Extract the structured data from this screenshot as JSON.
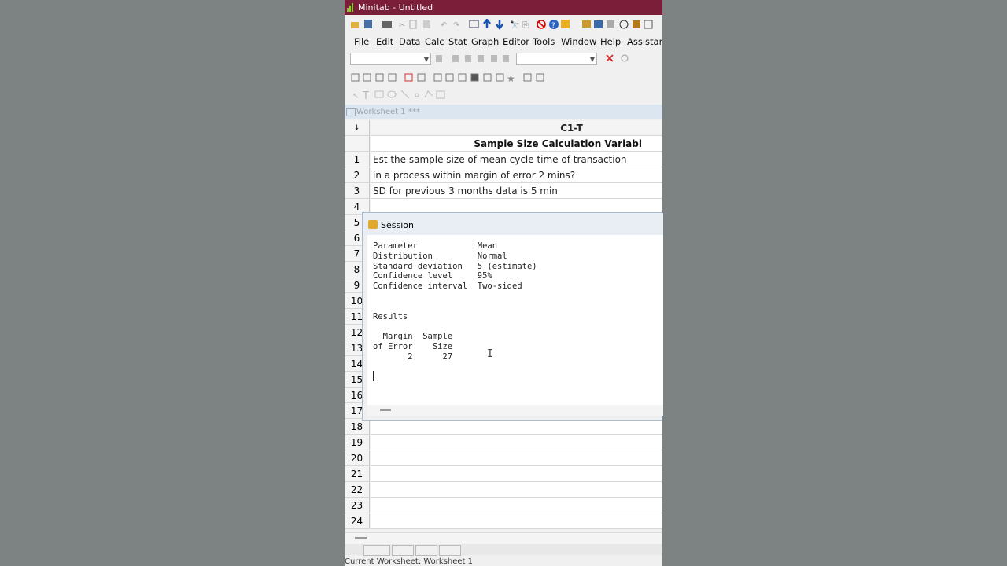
{
  "app": {
    "title": "Minitab - Untitled"
  },
  "menu": [
    "File",
    "Edit",
    "Data",
    "Calc",
    "Stat",
    "Graph",
    "Editor",
    "Tools",
    "Window",
    "Help",
    "Assistant"
  ],
  "worksheet": {
    "title": "Worksheet 1 ***",
    "column_id": "C1-T",
    "column_name": "Sample Size Calculation Variabl",
    "rows": [
      {
        "n": "1",
        "text": "Est the sample size of mean cycle time of transaction"
      },
      {
        "n": "2",
        "text": "in a process within margin of error 2 mins?"
      },
      {
        "n": "3",
        "text": "SD for previous 3 months data is 5 min"
      },
      {
        "n": "4",
        "text": ""
      },
      {
        "n": "5",
        "text": ""
      },
      {
        "n": "6",
        "text": ""
      },
      {
        "n": "7",
        "text": ""
      },
      {
        "n": "8",
        "text": ""
      },
      {
        "n": "9",
        "text": ""
      },
      {
        "n": "10",
        "text": ""
      },
      {
        "n": "11",
        "text": ""
      },
      {
        "n": "12",
        "text": ""
      },
      {
        "n": "13",
        "text": ""
      },
      {
        "n": "14",
        "text": ""
      },
      {
        "n": "15",
        "text": ""
      },
      {
        "n": "16",
        "text": ""
      },
      {
        "n": "17",
        "text": ""
      },
      {
        "n": "18",
        "text": ""
      },
      {
        "n": "19",
        "text": ""
      },
      {
        "n": "20",
        "text": ""
      },
      {
        "n": "21",
        "text": ""
      },
      {
        "n": "22",
        "text": ""
      },
      {
        "n": "23",
        "text": ""
      },
      {
        "n": "24",
        "text": ""
      }
    ]
  },
  "session": {
    "title": "Session",
    "output": "Parameter            Mean\nDistribution         Normal\nStandard deviation   5 (estimate)\nConfidence level     95%\nConfidence interval  Two-sided\n\n\nResults\n\n  Margin  Sample\nof Error    Size\n       2      27"
  },
  "status": {
    "text": "Current Worksheet: Worksheet 1"
  },
  "colors": {
    "title_bar": "#7a1e3a",
    "sheet_title": "#dbe6f0"
  }
}
